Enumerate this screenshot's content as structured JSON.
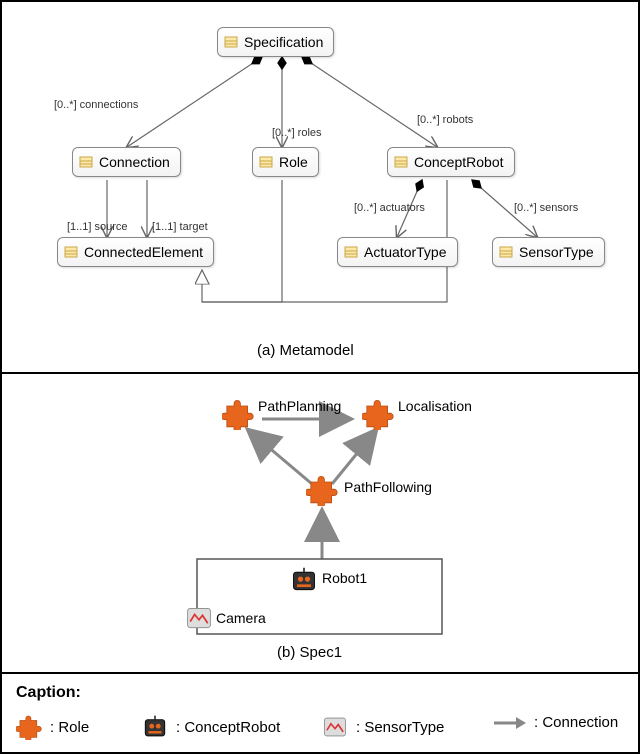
{
  "panel_a": {
    "caption": "(a) Metamodel",
    "classes": {
      "specification": "Specification",
      "connection": "Connection",
      "role": "Role",
      "conceptRobot": "ConceptRobot",
      "connectedElement": "ConnectedElement",
      "actuatorType": "ActuatorType",
      "sensorType": "SensorType"
    },
    "edges": {
      "connections": "[0..*] connections",
      "roles": "[0..*] roles",
      "robots": "[0..*] robots",
      "actuators": "[0..*] actuators",
      "sensors": "[0..*] sensors",
      "source": "[1..1] source",
      "target": "[1..1] target"
    }
  },
  "panel_b": {
    "caption": "(b) Spec1",
    "nodes": {
      "pathPlanning": "PathPlanning",
      "localisation": "Localisation",
      "pathFollowing": "PathFollowing",
      "robot1": "Robot1",
      "camera": "Camera"
    }
  },
  "legend": {
    "title": "Caption:",
    "role": ": Role",
    "conceptRobot": ": ConceptRobot",
    "sensorType": ": SensorType",
    "connection": ": Connection"
  }
}
